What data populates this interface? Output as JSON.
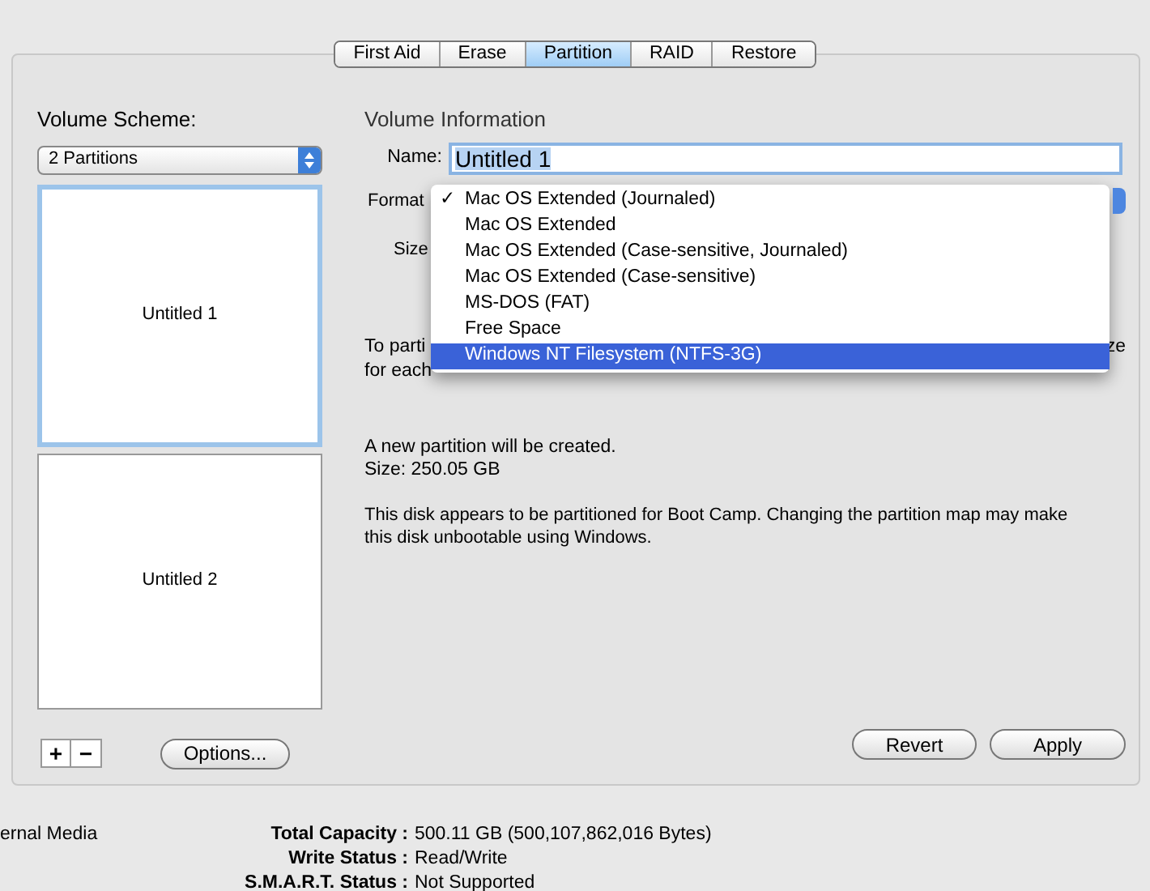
{
  "tabs": [
    {
      "label": "First Aid",
      "selected": false
    },
    {
      "label": "Erase",
      "selected": false
    },
    {
      "label": "Partition",
      "selected": true
    },
    {
      "label": "RAID",
      "selected": false
    },
    {
      "label": "Restore",
      "selected": false
    }
  ],
  "volume_scheme": {
    "label": "Volume Scheme:",
    "popup": "2 Partitions",
    "partitions": [
      {
        "name": "Untitled 1",
        "selected": true
      },
      {
        "name": "Untitled 2",
        "selected": false
      }
    ],
    "add": "+",
    "remove": "−",
    "options": "Options..."
  },
  "volume_info": {
    "title": "Volume Information",
    "name_label": "Name:",
    "name_value": "Untitled 1",
    "format_label": "Format",
    "size_label": "Size",
    "format_menu": [
      {
        "label": "Mac OS Extended (Journaled)",
        "checked": true,
        "selected": false
      },
      {
        "label": "Mac OS Extended",
        "checked": false,
        "selected": false
      },
      {
        "label": "Mac OS Extended (Case-sensitive, Journaled)",
        "checked": false,
        "selected": false
      },
      {
        "label": "Mac OS Extended (Case-sensitive)",
        "checked": false,
        "selected": false
      },
      {
        "label": "MS-DOS (FAT)",
        "checked": false,
        "selected": false
      },
      {
        "label": "Free Space",
        "checked": false,
        "selected": false
      },
      {
        "label": "Windows NT Filesystem (NTFS-3G)",
        "checked": false,
        "selected": true
      }
    ],
    "check_mark": "✓",
    "hint_parts": [
      "To parti",
      "ze",
      "for each"
    ],
    "status": [
      "A new partition will be created.",
      "Size: 250.05 GB"
    ],
    "warning": "This disk appears to be partitioned for Boot Camp. Changing the partition map may make this disk unbootable using Windows.",
    "buttons": [
      "Revert",
      "Apply"
    ]
  },
  "disk_info": {
    "media": "ernal Media",
    "rows": [
      {
        "label": "Total Capacity :",
        "value": "500.11 GB (500,107,862,016 Bytes)"
      },
      {
        "label": "Write Status :",
        "value": "Read/Write"
      },
      {
        "label": "S.M.A.R.T. Status :",
        "value": "Not Supported"
      }
    ]
  }
}
